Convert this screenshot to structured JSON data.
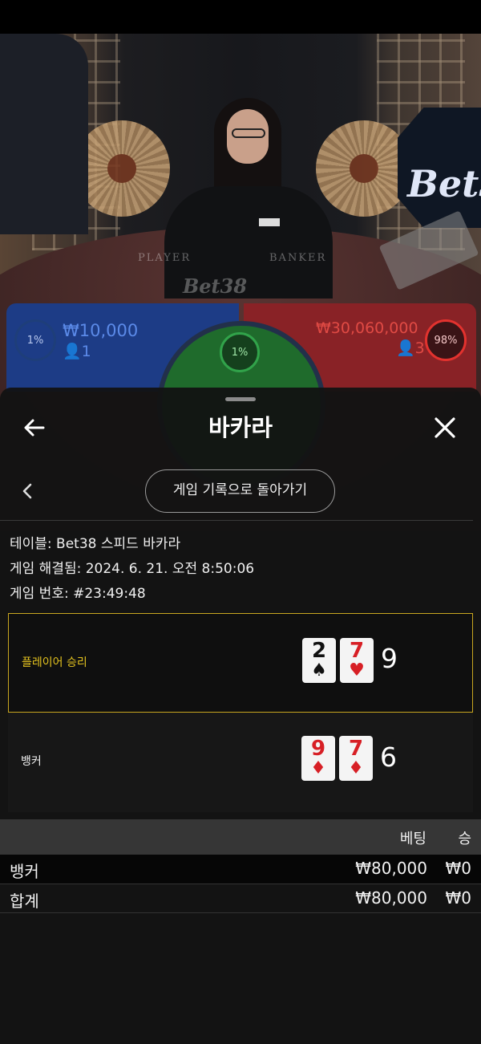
{
  "background": {
    "table_left_label": "PLAYER",
    "table_right_label": "BANKER",
    "brand_logo": "Bet38",
    "player_bet": {
      "amount": "₩10,000",
      "players": "1",
      "percent": "1%"
    },
    "banker_bet": {
      "amount": "₩30,060,000",
      "players": "3",
      "percent": "98%"
    },
    "tie_bet": {
      "percent": "1%"
    }
  },
  "modal": {
    "title": "바카라",
    "history_button": "게임 기록으로 돌아가기",
    "info": {
      "table": "테이블: Bet38 스피드 바카라",
      "resolved": "게임 해결됨: 2024. 6. 21. 오전 8:50:06",
      "round": "게임 번호: #23:49:48"
    },
    "player_hand": {
      "label": "플레이어 승리",
      "cards": [
        {
          "rank": "2",
          "suit": "♠",
          "color": "#111111"
        },
        {
          "rank": "7",
          "suit": "♥",
          "color": "#d71f25"
        }
      ],
      "score": "9"
    },
    "banker_hand": {
      "label": "뱅커",
      "cards": [
        {
          "rank": "9",
          "suit": "♦",
          "color": "#d71f25"
        },
        {
          "rank": "7",
          "suit": "♦",
          "color": "#d71f25"
        }
      ],
      "score": "6"
    },
    "bets_table": {
      "headers": {
        "bet": "베팅",
        "win": "승"
      },
      "rows": [
        {
          "name": "뱅커",
          "bet": "₩80,000",
          "win": "₩0"
        },
        {
          "name": "합계",
          "bet": "₩80,000",
          "win": "₩0"
        }
      ]
    }
  }
}
